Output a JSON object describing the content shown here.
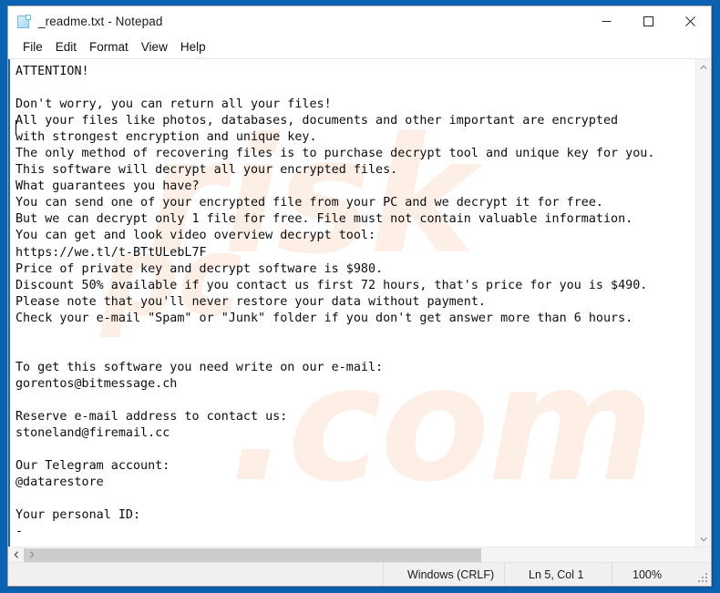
{
  "window": {
    "title": "_readme.txt - Notepad",
    "icon": "notepad-document-icon",
    "controls": {
      "minimize": "Minimize",
      "maximize": "Maximize",
      "close": "Close"
    }
  },
  "menu": {
    "items": [
      {
        "label": "File"
      },
      {
        "label": "Edit"
      },
      {
        "label": "Format"
      },
      {
        "label": "View"
      },
      {
        "label": "Help"
      }
    ]
  },
  "document": {
    "text": "ATTENTION!\n\nDon't worry, you can return all your files!\nAll your files like photos, databases, documents and other important are encrypted\nwith strongest encryption and unique key.\nThe only method of recovering files is to purchase decrypt tool and unique key for you.\nThis software will decrypt all your encrypted files.\nWhat guarantees you have?\nYou can send one of your encrypted file from your PC and we decrypt it for free.\nBut we can decrypt only 1 file for free. File must not contain valuable information.\nYou can get and look video overview decrypt tool:\nhttps://we.tl/t-BTtULebL7F\nPrice of private key and decrypt software is $980.\nDiscount 50% available if you contact us first 72 hours, that's price for you is $490.\nPlease note that you'll never restore your data without payment.\nCheck your e-mail \"Spam\" or \"Junk\" folder if you don't get answer more than 6 hours.\n\n\nTo get this software you need write on our e-mail:\ngorentos@bitmessage.ch\n\nReserve e-mail address to contact us:\nstoneland@firemail.cc\n\nOur Telegram account:\n@datarestore\n\nYour personal ID:\n-",
    "watermark": {
      "line1": "risk",
      "line2": ".com",
      "line3": "pc"
    }
  },
  "scrollbars": {
    "vertical_up": "scroll-up",
    "vertical_down": "scroll-down",
    "horizontal_left": "scroll-left",
    "horizontal_right": "scroll-right"
  },
  "statusbar": {
    "encoding": "Windows (CRLF)",
    "position": "Ln 5, Col 1",
    "zoom": "100%"
  },
  "colors": {
    "desktop_blue": "#0a62b0",
    "accent_border": "#1867ac",
    "scroll_thumb": "#cdcdcd",
    "status_bg": "#f0f0f0"
  }
}
